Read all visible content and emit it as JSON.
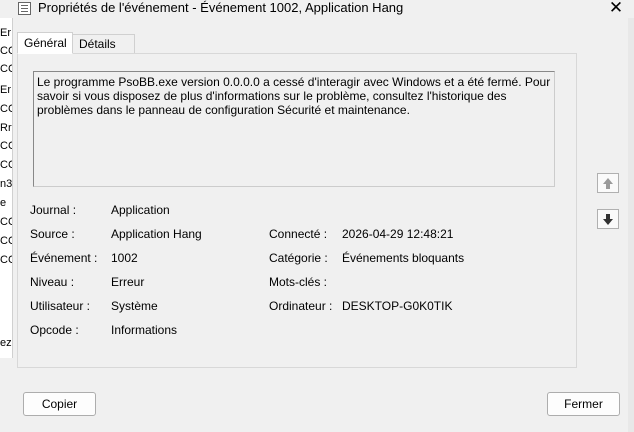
{
  "window": {
    "title": "Propriétés de l'événement - Événement 1002, Application Hang",
    "close_glyph": "✕"
  },
  "background": {
    "fragments": [
      "Er",
      "CC",
      "CC",
      "Er",
      "CC",
      "Rr",
      "CC",
      "CC",
      "n3",
      "e",
      "CC",
      "CC",
      "CC"
    ],
    "below": "ez"
  },
  "tabs": [
    {
      "label": "Général",
      "active": true
    },
    {
      "label": "Détails",
      "active": false
    }
  ],
  "description": "Le programme PsoBB.exe version 0.0.0.0 a cessé d'interagir avec Windows et a été fermé. Pour savoir si vous disposez de plus d'informations sur le problème, consultez l'historique des problèmes dans le panneau de configuration Sécurité et maintenance.",
  "details": {
    "journal": {
      "label": "Journal :",
      "value": "Application"
    },
    "source": {
      "label": "Source :",
      "value": "Application Hang"
    },
    "event": {
      "label": "Événement :",
      "value": "1002"
    },
    "level": {
      "label": "Niveau :",
      "value": "Erreur"
    },
    "user": {
      "label": "Utilisateur :",
      "value": "Système"
    },
    "opcode": {
      "label": "Opcode :",
      "value": "Informations"
    },
    "logged": {
      "label": "Connecté :",
      "value": "2026-04-29 12:48:21"
    },
    "category": {
      "label": "Catégorie :",
      "value": "Événements bloquants"
    },
    "keywords": {
      "label": "Mots-clés :",
      "value": ""
    },
    "computer": {
      "label": "Ordinateur :",
      "value": "DESKTOP-G0K0TIK"
    }
  },
  "buttons": {
    "copy": "Copier",
    "close": "Fermer"
  },
  "icons": {
    "up": "arrow-up-icon",
    "down": "arrow-down-icon"
  }
}
